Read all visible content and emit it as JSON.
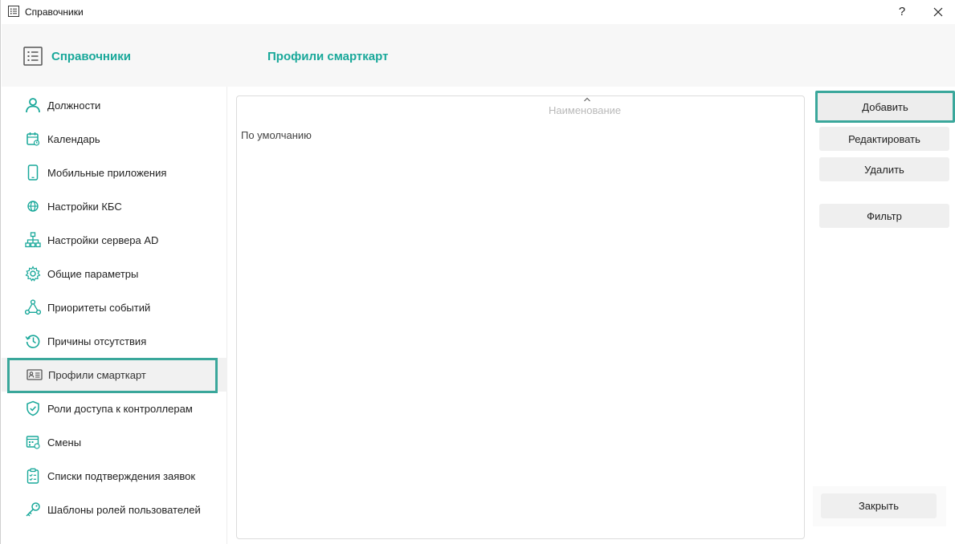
{
  "window": {
    "title": "Справочники",
    "help_label": "?"
  },
  "header": {
    "title": "Справочники",
    "page_title": "Профили смарткарт"
  },
  "sidebar": {
    "items": [
      {
        "label": "Должности",
        "icon": "person-icon"
      },
      {
        "label": "Календарь",
        "icon": "calendar-icon"
      },
      {
        "label": "Мобильные приложения",
        "icon": "mobile-icon"
      },
      {
        "label": "Настройки КБС",
        "icon": "globe-icon"
      },
      {
        "label": "Настройки сервера AD",
        "icon": "network-icon"
      },
      {
        "label": "Общие параметры",
        "icon": "gear-icon"
      },
      {
        "label": "Приоритеты событий",
        "icon": "nodes-icon"
      },
      {
        "label": "Причины отсутствия",
        "icon": "history-icon"
      },
      {
        "label": "Профили смарткарт",
        "icon": "id-card-icon",
        "active": true
      },
      {
        "label": "Роли доступа к контроллерам",
        "icon": "shield-check-icon"
      },
      {
        "label": "Смены",
        "icon": "shift-calendar-icon"
      },
      {
        "label": "Списки подтверждения заявок",
        "icon": "clipboard-check-icon"
      },
      {
        "label": "Шаблоны ролей пользователей",
        "icon": "key-icon"
      }
    ]
  },
  "list": {
    "column_header": "Наименование",
    "rows": [
      "По умолчанию"
    ]
  },
  "actions": {
    "add_label": "Добавить",
    "edit_label": "Редактировать",
    "delete_label": "Удалить",
    "filter_label": "Фильтр",
    "close_label": "Закрыть"
  },
  "colors": {
    "accent": "#19a89a",
    "highlight_border": "#3aa79b",
    "button_bg": "#efefef"
  }
}
